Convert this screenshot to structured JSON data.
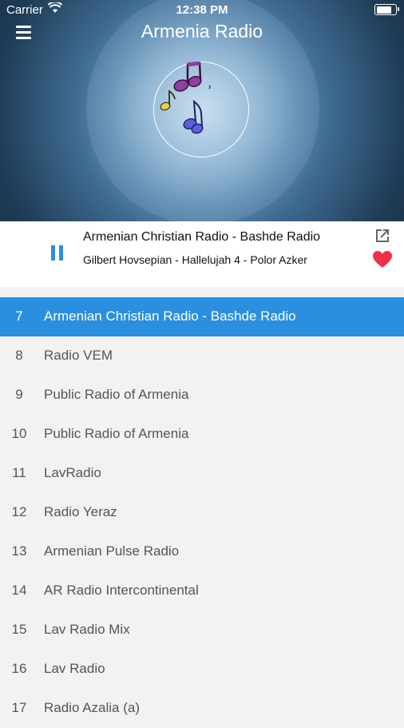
{
  "status_bar": {
    "carrier": "Carrier",
    "time": "12:38 PM",
    "battery_level": 0.9
  },
  "header": {
    "title": "Armenia Radio",
    "menu_icon": "hamburger-menu-icon"
  },
  "logo": {
    "icon": "music-notes-icon"
  },
  "now_playing": {
    "station": "Armenian Christian Radio - Bashde Radio",
    "track": "Gilbert Hovsepian - Hallelujah 4 - Polor Azker",
    "pause_icon": "pause-icon",
    "share_icon": "share-external-icon",
    "favorite_icon": "heart-icon",
    "favorite_color": "#ee3148",
    "accent_color": "#2b8fe0"
  },
  "stations": [
    {
      "num": "7",
      "name": "Armenian Christian Radio - Bashde Radio",
      "active": true
    },
    {
      "num": "8",
      "name": "Radio VEM"
    },
    {
      "num": "9",
      "name": "Public Radio of Armenia"
    },
    {
      "num": "10",
      "name": "Public Radio of Armenia"
    },
    {
      "num": "11",
      "name": "LavRadio"
    },
    {
      "num": "12",
      "name": "Radio Yeraz"
    },
    {
      "num": "13",
      "name": "Armenian Pulse Radio"
    },
    {
      "num": "14",
      "name": "AR Radio Intercontinental"
    },
    {
      "num": "15",
      "name": "Lav Radio Mix"
    },
    {
      "num": "16",
      "name": "Lav Radio"
    },
    {
      "num": "17",
      "name": "Radio Azalia (a)"
    }
  ]
}
